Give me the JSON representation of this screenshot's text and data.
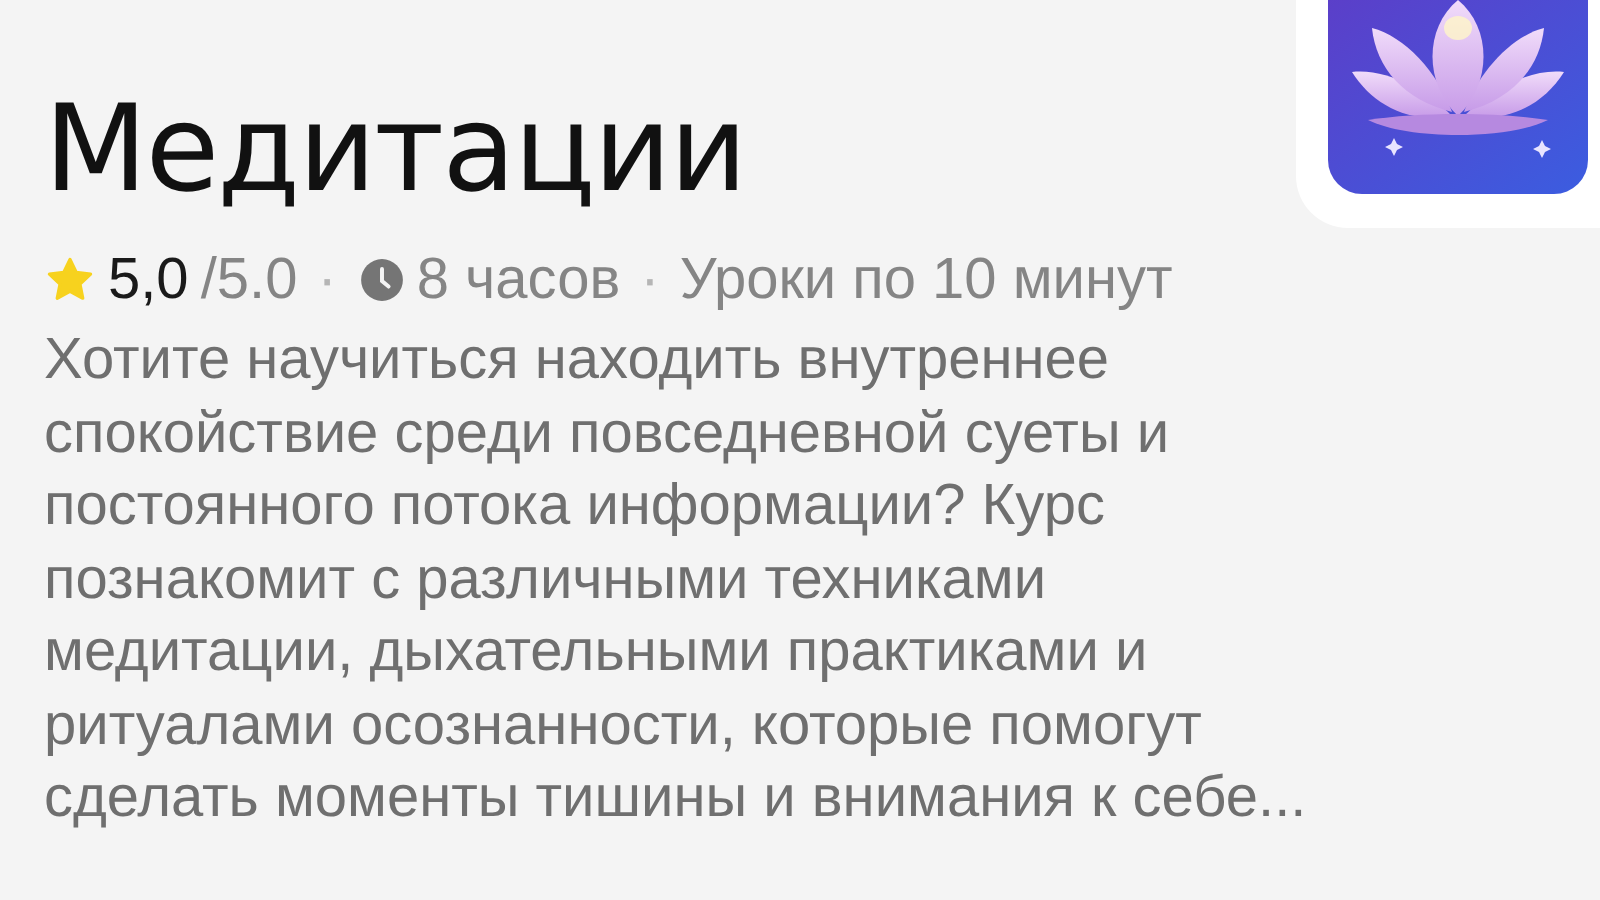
{
  "title": "Медитации",
  "meta": {
    "rating": "5,0",
    "rating_max": "/5.0",
    "separator": "·",
    "duration": "8 часов",
    "lessons": "Уроки по 10 минут"
  },
  "description": "Хотите научиться находить внутреннее спокойствие среди повседневной суеты и постоянного потока информации? Курс познакомит с различными техниками медитации, дыхательными практиками и ритуалами осознанности, которые помогут сделать моменты тишины и внимания к себе..."
}
